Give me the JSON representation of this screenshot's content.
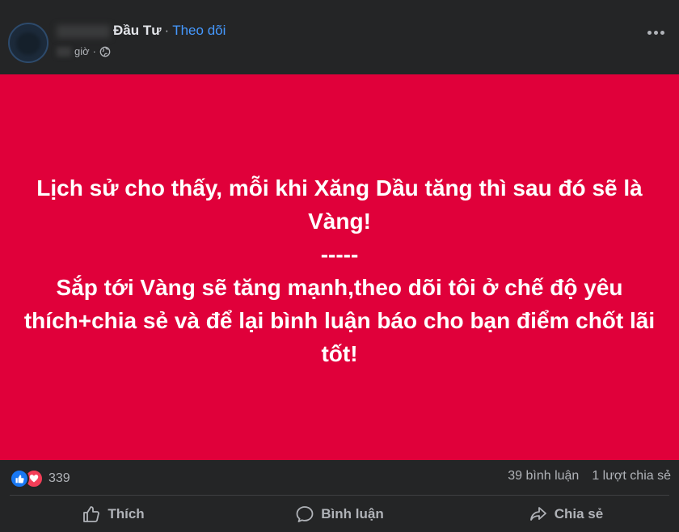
{
  "post": {
    "author_name": "Đầu Tư",
    "separator": "·",
    "follow_label": "Theo dõi",
    "time": "giờ",
    "time_separator": "·",
    "more_icon": "more-options-icon"
  },
  "banner": {
    "background": "#e0003a",
    "lines": [
      "Lịch sử cho thấy, mỗi khi Xăng Dầu tăng thì sau đó sẽ là Vàng!",
      "-----",
      "Sắp tới Vàng sẽ tăng mạnh,theo dõi tôi ở chế độ yêu thích+chia sẻ và để lại bình luận báo cho bạn điểm chốt lãi tốt!"
    ]
  },
  "stats": {
    "reaction_count": "339",
    "comments": "39 bình luận",
    "shares": "1 lượt chia sẻ"
  },
  "actions": {
    "like": "Thích",
    "comment": "Bình luận",
    "share": "Chia sẻ"
  },
  "colors": {
    "background": "#242526",
    "link": "#4599ff",
    "like": "#1877f2",
    "love": "#f33e58"
  }
}
